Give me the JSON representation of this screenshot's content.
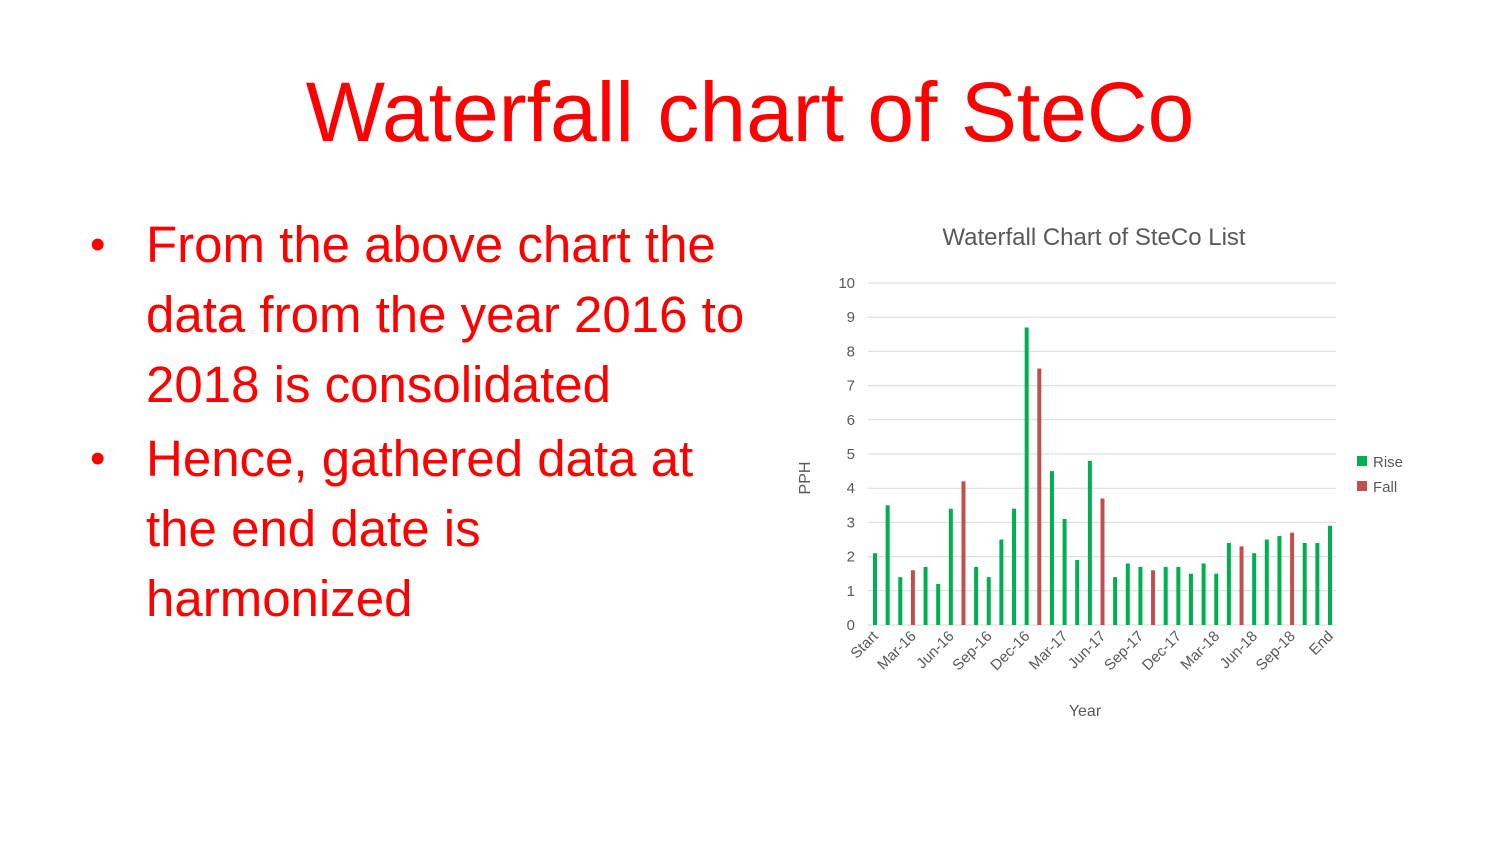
{
  "slide": {
    "title": "Waterfall chart of SteCo",
    "bullets": [
      "From the above chart the data from the year 2016 to 2018 is consolidated",
      "Hence, gathered data at the end date is harmonized"
    ]
  },
  "chart_data": {
    "type": "bar",
    "title": "Waterfall Chart of SteCo List",
    "xlabel": "Year",
    "ylabel": "PPH",
    "ylim": [
      0,
      10
    ],
    "yticks": [
      "0",
      "1",
      "2",
      "3",
      "4",
      "5",
      "6",
      "7",
      "8",
      "9",
      "10"
    ],
    "grid": true,
    "legend_position": "right",
    "x_tick_labels": [
      "Start",
      "Mar-16",
      "Jun-16",
      "Sep-16",
      "Dec-16",
      "Mar-17",
      "Jun-17",
      "Sep-17",
      "Dec-17",
      "Mar-18",
      "Jun-18",
      "Sep-18",
      "End"
    ],
    "values": [
      2.1,
      3.5,
      1.4,
      1.6,
      1.7,
      1.2,
      3.4,
      4.2,
      1.7,
      1.4,
      2.5,
      3.4,
      8.7,
      7.5,
      4.5,
      3.1,
      1.9,
      4.8,
      3.7,
      1.4,
      1.8,
      1.7,
      1.6,
      1.7,
      1.7,
      1.5,
      1.8,
      1.5,
      2.4,
      2.3,
      2.1,
      2.5,
      2.6,
      2.7,
      2.4,
      2.4,
      2.9
    ],
    "bar_series": [
      "Rise",
      "Rise",
      "Rise",
      "Fall",
      "Rise",
      "Rise",
      "Rise",
      "Fall",
      "Rise",
      "Rise",
      "Rise",
      "Rise",
      "Rise",
      "Fall",
      "Rise",
      "Rise",
      "Rise",
      "Rise",
      "Fall",
      "Rise",
      "Rise",
      "Rise",
      "Fall",
      "Rise",
      "Rise",
      "Rise",
      "Rise",
      "Rise",
      "Rise",
      "Fall",
      "Rise",
      "Rise",
      "Rise",
      "Fall",
      "Rise",
      "Rise",
      "Rise"
    ],
    "series": [
      {
        "name": "Rise",
        "color": "#00b050"
      },
      {
        "name": "Fall",
        "color": "#c0504d"
      }
    ]
  }
}
